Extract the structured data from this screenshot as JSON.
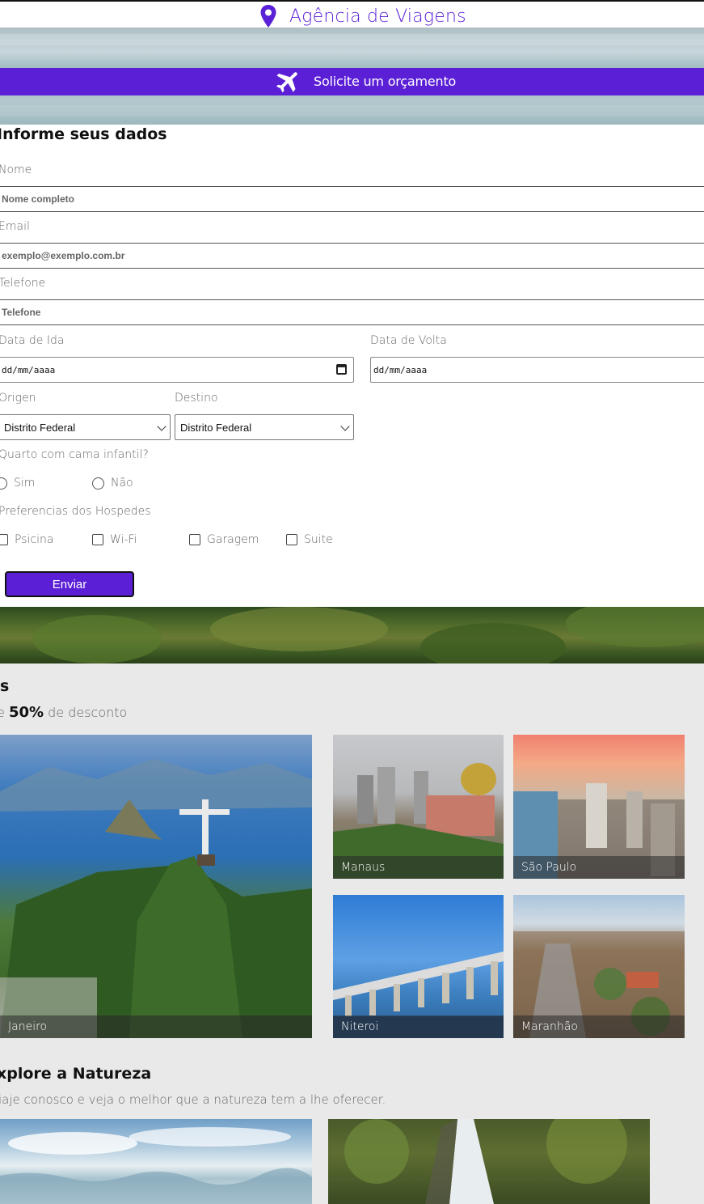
{
  "header": {
    "brand": "Agência de Viagens",
    "icon": "map-pin-icon"
  },
  "banner": {
    "quote_label": "Solicite um orçamento",
    "icon": "airplane-icon"
  },
  "form": {
    "title": "Informe seus dados",
    "name_label": "Nome",
    "name_placeholder": "Nome completo",
    "email_label": "Email",
    "email_placeholder": "exemplo@exemplo.com.br",
    "phone_label": "Telefone",
    "phone_placeholder": "Telefone",
    "departure_label": "Data de Ida",
    "departure_value": "dd/mm/aaaa",
    "return_label": "Data de Volta",
    "return_value": "dd/mm/aaaa",
    "origin_label": "Origen",
    "origin_value": "Distrito Federal",
    "destination_label": "Destino",
    "destination_value": "Distrito Federal",
    "crib_question": "Quarto com cama infantil?",
    "crib_options": [
      "Sim",
      "Não"
    ],
    "prefs_label": "Preferencias dos Hospedes",
    "prefs_options": [
      "Psicina",
      "Wi-Fi",
      "Garagem",
      "Suite"
    ],
    "submit_label": "Enviar"
  },
  "offers": {
    "title": "s",
    "subtitle_prefix": "e",
    "discount": "50%",
    "subtitle_suffix": "de desconto",
    "destinations": [
      "Janeiro",
      "Manaus",
      "São Paulo",
      "Niteroi",
      "Maranhão"
    ]
  },
  "nature": {
    "title": "xplore a Natureza",
    "subtitle": "iaje conosco e veja o melhor que a natureza tem a lhe oferecer."
  },
  "colors": {
    "accent": "#5b1fd6",
    "section_bg": "#e9e9e9"
  }
}
